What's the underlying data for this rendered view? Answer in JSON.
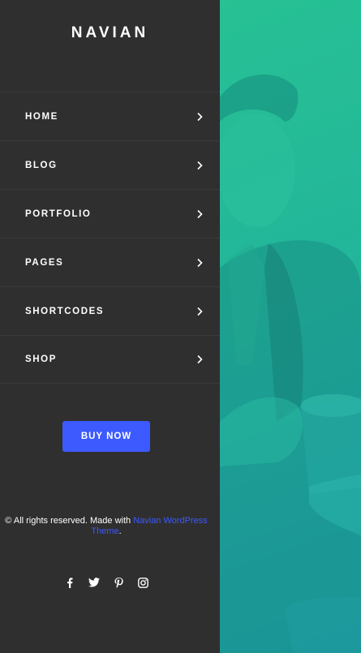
{
  "brand": {
    "logo": "NAVIAN"
  },
  "menu": {
    "items": [
      {
        "label": "HOME"
      },
      {
        "label": "BLOG"
      },
      {
        "label": "PORTFOLIO"
      },
      {
        "label": "PAGES"
      },
      {
        "label": "SHORTCODES"
      },
      {
        "label": "SHOP"
      }
    ]
  },
  "cta": {
    "label": "BUY NOW"
  },
  "footer": {
    "prefix": "© All rights reserved. Made with ",
    "link": "Navian WordPress Theme",
    "suffix": "."
  },
  "socials": [
    "facebook-icon",
    "twitter-icon",
    "pinterest-icon",
    "instagram-icon"
  ],
  "colors": {
    "panel": "#2f2f2f",
    "accent": "#3d5afe",
    "hero_top": "#27c194",
    "hero_bottom": "#1c9aa8"
  }
}
